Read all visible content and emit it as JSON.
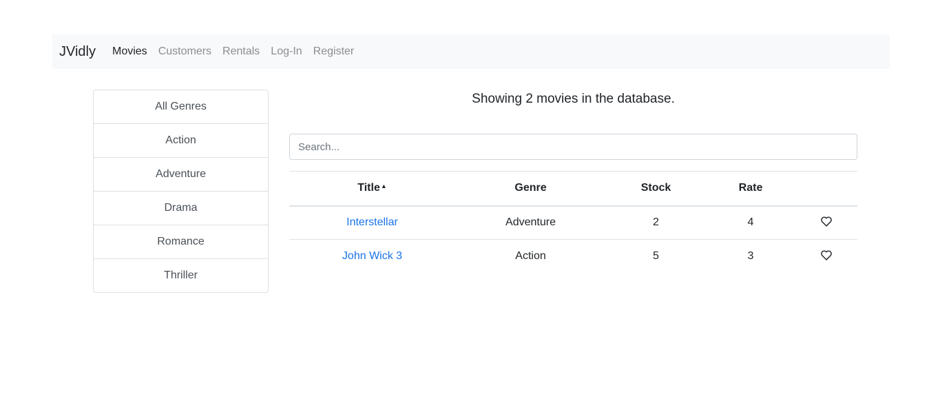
{
  "navbar": {
    "brand": "JVidly",
    "links": [
      "Movies",
      "Customers",
      "Rentals",
      "Log-In",
      "Register"
    ]
  },
  "genres": [
    "All Genres",
    "Action",
    "Adventure",
    "Drama",
    "Romance",
    "Thriller"
  ],
  "main": {
    "count_text": "Showing 2 movies in the database.",
    "search_placeholder": "Search..."
  },
  "table": {
    "headers": [
      "Title",
      "Genre",
      "Stock",
      "Rate"
    ],
    "sort_icon": "caret-up-icon",
    "rows": [
      {
        "title": "Interstellar",
        "genre": "Adventure",
        "stock": "2",
        "rate": "4",
        "like_icon": "heart-outline-icon"
      },
      {
        "title": "John Wick 3",
        "genre": "Action",
        "stock": "5",
        "rate": "3",
        "like_icon": "heart-outline-icon"
      }
    ]
  },
  "colors": {
    "navbar_bg": "#f8f9fa",
    "link_blue": "#1a73e8",
    "muted_nav": "#8a8d91"
  }
}
